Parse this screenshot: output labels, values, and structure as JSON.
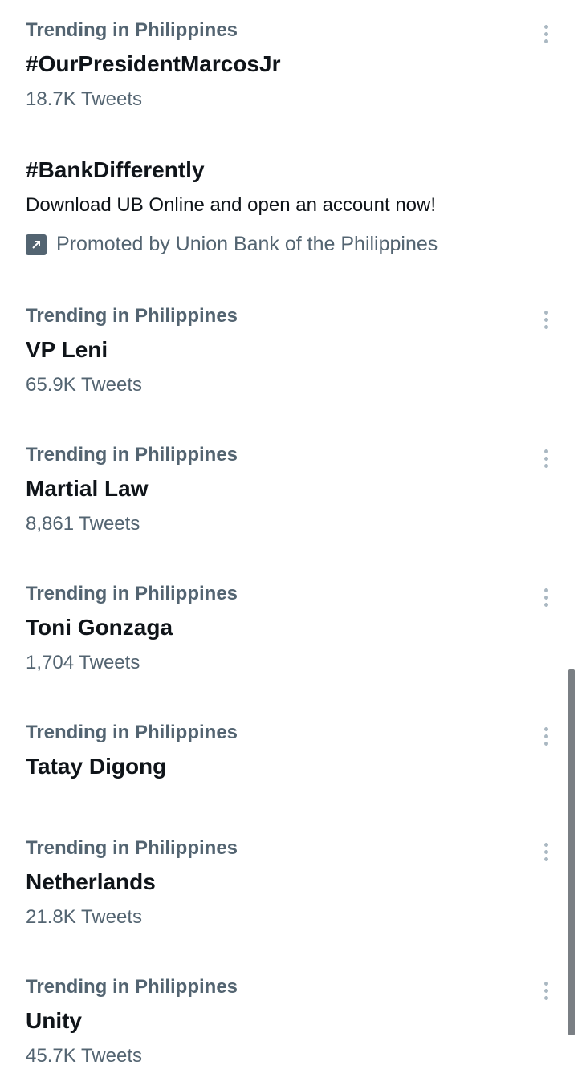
{
  "trends": [
    {
      "context": "Trending in Philippines",
      "name": "#OurPresidentMarcosJr",
      "count": "18.7K Tweets"
    },
    {
      "context": "Trending in Philippines",
      "name": "VP Leni",
      "count": "65.9K Tweets"
    },
    {
      "context": "Trending in Philippines",
      "name": "Martial Law",
      "count": "8,861 Tweets"
    },
    {
      "context": "Trending in Philippines",
      "name": "Toni Gonzaga",
      "count": "1,704 Tweets"
    },
    {
      "context": "Trending in Philippines",
      "name": "Tatay Digong",
      "count": ""
    },
    {
      "context": "Trending in Philippines",
      "name": "Netherlands",
      "count": "21.8K Tweets"
    },
    {
      "context": "Trending in Philippines",
      "name": "Unity",
      "count": "45.7K Tweets"
    }
  ],
  "promoted": {
    "hashtag": "#BankDifferently",
    "description": "Download UB Online and open an account now!",
    "promoted_by": "Promoted by Union Bank of the Philippines",
    "icon": "promoted-arrow-icon"
  },
  "colors": {
    "secondary_text": "#536471",
    "primary_text": "#0f1419",
    "more_dots": "#aab8c2"
  }
}
